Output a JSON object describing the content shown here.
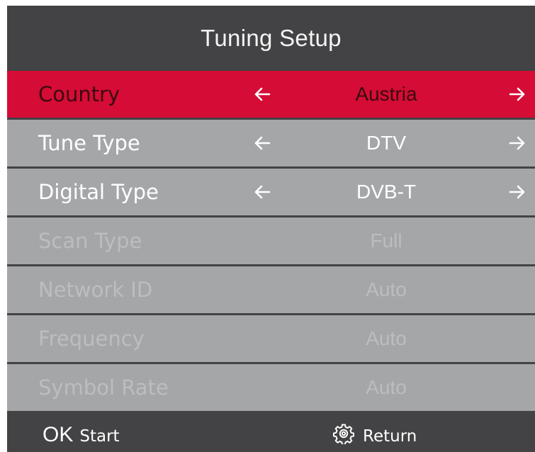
{
  "menu": {
    "title": "Tuning Setup",
    "rows": [
      {
        "label": "Country",
        "value": "Austria",
        "state": "selected",
        "arrows": true
      },
      {
        "label": "Tune Type",
        "value": "DTV",
        "state": "enabled",
        "arrows": true
      },
      {
        "label": "Digital Type",
        "value": "DVB-T",
        "state": "enabled",
        "arrows": true
      },
      {
        "label": "Scan Type",
        "value": "Full",
        "state": "disabled",
        "arrows": false
      },
      {
        "label": "Network ID",
        "value": "Auto",
        "state": "disabled",
        "arrows": false
      },
      {
        "label": "Frequency",
        "value": "Auto",
        "state": "disabled",
        "arrows": false
      },
      {
        "label": "Symbol Rate",
        "value": "Auto",
        "state": "disabled",
        "arrows": false
      }
    ]
  },
  "footer": {
    "ok_key": "OK",
    "ok_label": "Start",
    "return_icon": "gear-icon",
    "return_label": "Return"
  },
  "colors": {
    "background": "#434244",
    "row": "#a5a6a8",
    "selected": "#d50c35",
    "selected_text": "#3a0a10",
    "disabled_text": "#bcbdbf"
  }
}
